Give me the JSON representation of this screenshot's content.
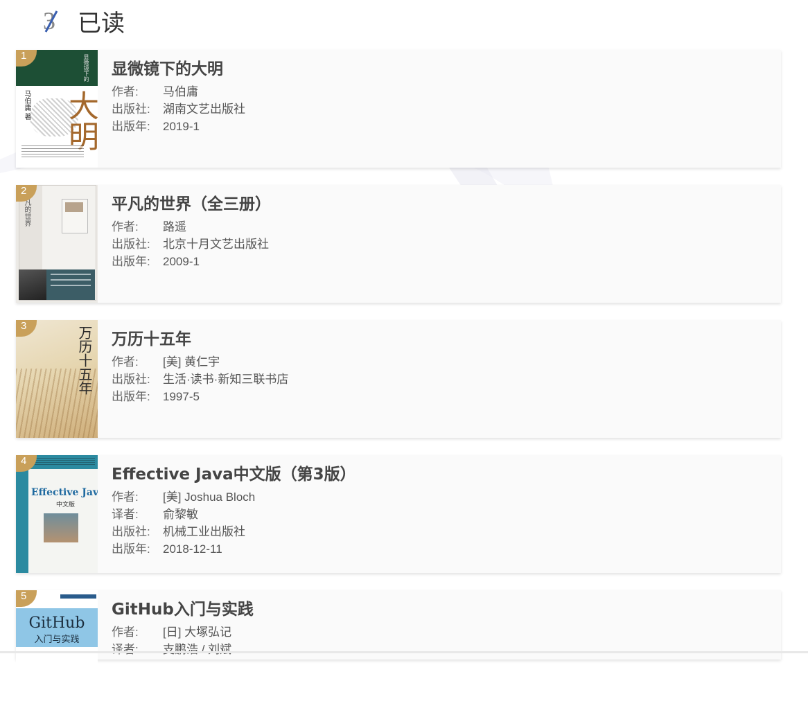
{
  "header": {
    "icon_glyph": "3",
    "title": "已读"
  },
  "books": [
    {
      "rank": "1",
      "title": "显微镜下的大明",
      "rows": [
        {
          "label": "作者:",
          "value": "马伯庸"
        },
        {
          "label": "出版社:",
          "value": "湖南文艺出版社"
        },
        {
          "label": "出版年:",
          "value": "2019-1"
        }
      ],
      "cover": {
        "big": "大明",
        "side": "马伯庸 著"
      }
    },
    {
      "rank": "2",
      "title": "平凡的世界（全三册）",
      "rows": [
        {
          "label": "作者:",
          "value": "路遥"
        },
        {
          "label": "出版社:",
          "value": "北京十月文艺出版社"
        },
        {
          "label": "出版年:",
          "value": "2009-1"
        }
      ],
      "cover": {
        "side": "平凡的世界"
      }
    },
    {
      "rank": "3",
      "title": "万历十五年",
      "rows": [
        {
          "label": "作者:",
          "value": "[美] 黄仁宇"
        },
        {
          "label": "出版社:",
          "value": "生活·读书·新知三联书店"
        },
        {
          "label": "出版年:",
          "value": "1997-5"
        }
      ],
      "cover": {
        "big": "万历十五年"
      }
    },
    {
      "rank": "4",
      "title": "Effective Java中文版（第3版）",
      "rows": [
        {
          "label": "作者:",
          "value": "[美] Joshua Bloch"
        },
        {
          "label": "译者:",
          "value": "俞黎敏"
        },
        {
          "label": "出版社:",
          "value": "机械工业出版社"
        },
        {
          "label": "出版年:",
          "value": "2018-12-11"
        }
      ],
      "cover": {
        "big": "Effective Java",
        "side": "中文版"
      }
    },
    {
      "rank": "5",
      "title": "GitHub入门与实践",
      "rows": [
        {
          "label": "作者:",
          "value": "[日] 大塚弘记"
        },
        {
          "label": "译者:",
          "value": "支鹏浩 / 刘斌"
        }
      ],
      "cover": {
        "big": "GitHub",
        "side": "入门与实践"
      }
    }
  ],
  "colors": {
    "rank_badge": "#c9a05a",
    "card_bg": "#fafafa",
    "title_text": "#444444",
    "meta_text": "#666666"
  }
}
